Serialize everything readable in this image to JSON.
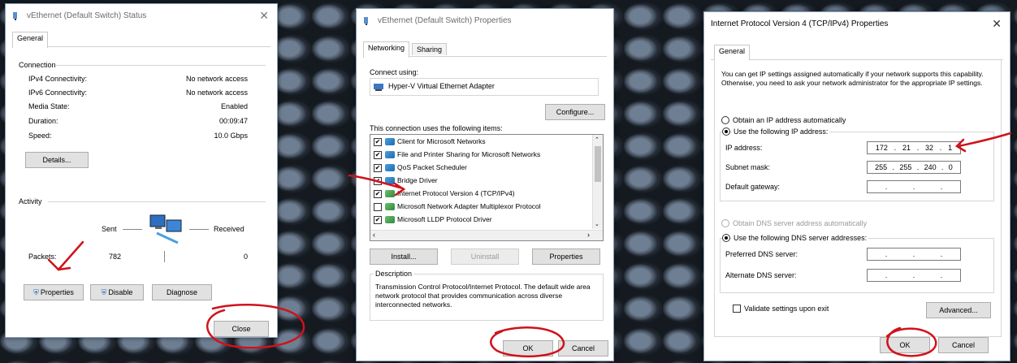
{
  "win1": {
    "title": "vEthernet (Default Switch) Status",
    "tab_general": "General",
    "connection_heading": "Connection",
    "rows": [
      {
        "label": "IPv4 Connectivity:",
        "value": "No network access"
      },
      {
        "label": "IPv6 Connectivity:",
        "value": "No network access"
      },
      {
        "label": "Media State:",
        "value": "Enabled"
      },
      {
        "label": "Duration:",
        "value": "00:09:47"
      },
      {
        "label": "Speed:",
        "value": "10.0 Gbps"
      }
    ],
    "details_label": "Details...",
    "activity_heading": "Activity",
    "sent_label": "Sent",
    "received_label": "Received",
    "packets_label": "Packets:",
    "packets_sent": "782",
    "packets_received": "0",
    "properties_label": "Properties",
    "disable_label": "Disable",
    "diagnose_label": "Diagnose",
    "close_label": "Close"
  },
  "win2": {
    "title": "vEthernet (Default Switch) Properties",
    "tab_networking": "Networking",
    "tab_sharing": "Sharing",
    "connect_using": "Connect using:",
    "adapter": "Hyper-V Virtual Ethernet Adapter",
    "configure_label": "Configure...",
    "items_heading": "This connection uses the following items:",
    "items": [
      {
        "label": "Client for Microsoft Networks",
        "checked": true
      },
      {
        "label": "File and Printer Sharing for Microsoft Networks",
        "checked": true
      },
      {
        "label": "QoS Packet Scheduler",
        "checked": true
      },
      {
        "label": "Bridge Driver",
        "checked": true
      },
      {
        "label": "Internet Protocol Version 4 (TCP/IPv4)",
        "checked": true
      },
      {
        "label": "Microsoft Network Adapter Multiplexor Protocol",
        "checked": false
      },
      {
        "label": "Microsoft LLDP Protocol Driver",
        "checked": true
      }
    ],
    "install_label": "Install...",
    "uninstall_label": "Uninstall",
    "properties_label": "Properties",
    "description_heading": "Description",
    "description": "Transmission Control Protocol/Internet Protocol. The default wide area network protocol that provides communication across diverse interconnected networks.",
    "ok_label": "OK",
    "cancel_label": "Cancel"
  },
  "win3": {
    "title": "Internet Protocol Version 4 (TCP/IPv4) Properties",
    "tab_general": "General",
    "intro": "You can get IP settings assigned automatically if your network supports this capability. Otherwise, you need to ask your network administrator for the appropriate IP settings.",
    "obtain_ip_auto": "Obtain an IP address automatically",
    "use_following_ip": "Use the following IP address:",
    "ip_label": "IP address:",
    "ip_value": [
      "172",
      "21",
      "32",
      "1"
    ],
    "subnet_label": "Subnet mask:",
    "subnet_value": [
      "255",
      "255",
      "240",
      "0"
    ],
    "gateway_label": "Default gateway:",
    "obtain_dns_auto": "Obtain DNS server address automatically",
    "use_following_dns": "Use the following DNS server addresses:",
    "preferred_dns_label": "Preferred DNS server:",
    "alternate_dns_label": "Alternate DNS server:",
    "validate_label": "Validate settings upon exit",
    "advanced_label": "Advanced...",
    "ok_label": "OK",
    "cancel_label": "Cancel"
  }
}
